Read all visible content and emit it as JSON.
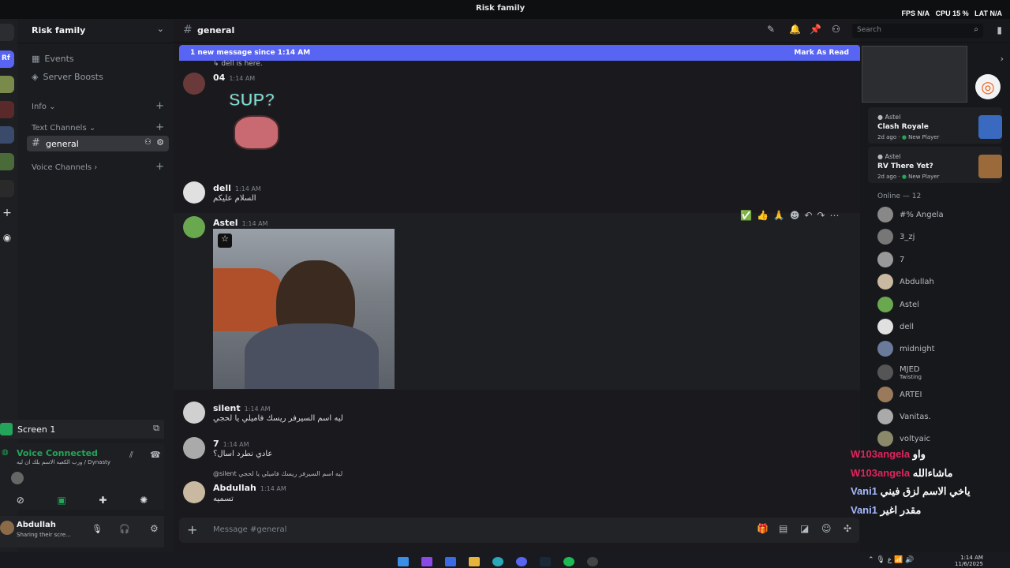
{
  "window": {
    "title": "Risk family"
  },
  "perf": {
    "fps_label": "FPS",
    "fps_value": "N/A",
    "cpu_label": "CPU",
    "cpu_value": "15 %",
    "lat_label": "LAT",
    "lat_value": "N/A"
  },
  "server": {
    "name": "Risk family"
  },
  "sidebar": {
    "events": "Events",
    "boosts": "Server Boosts",
    "info": "Info",
    "text_channels": "Text Channels",
    "general": "general",
    "voice_channels": "Voice Channels"
  },
  "screen_share": {
    "label": "Screen 1"
  },
  "voice": {
    "status": "Voice Connected",
    "details": "ورب الكعبه الاسم بلك ان ليه / Dynasty"
  },
  "user": {
    "name": "Abdullah",
    "status": "Sharing their scre..."
  },
  "header": {
    "channel": "general",
    "search_placeholder": "Search"
  },
  "banner": {
    "text": "1 new message since 1:14 AM",
    "action": "Mark As Read"
  },
  "messages": [
    {
      "reply": "dell is here."
    },
    {
      "author": "04",
      "time": "1:14 AM",
      "sticker": "SUP?"
    },
    {
      "author": "dell",
      "time": "1:14 AM",
      "text": "السلام عليكم"
    },
    {
      "author": "Astel",
      "time": "1:14 AM"
    },
    {
      "author": "silent",
      "time": "1:14 AM",
      "text": "ليه اسم السيرفر ريسك فاميلي يا لحجي"
    },
    {
      "author": "7",
      "time": "1:14 AM",
      "text": "عادي نطرد اسال؟"
    },
    {
      "author": "Abdullah",
      "time": "1:14 AM",
      "text": "تسميه",
      "reply_user": "@silent",
      "reply_text": "ليه اسم السيرفر ريسك فاميلي يا لحجي"
    }
  ],
  "composer": {
    "placeholder": "Message #general"
  },
  "activity": [
    {
      "user": "Astel",
      "game": "Clash Royale",
      "ago": "2d ago",
      "tag": "New Player"
    },
    {
      "user": "Astel",
      "game": "RV There Yet?",
      "ago": "2d ago",
      "tag": "New Player"
    }
  ],
  "online": {
    "header": "Online — 12"
  },
  "members": [
    {
      "name": "#% Angela",
      "color": "#b5bac1"
    },
    {
      "name": "3_zj",
      "color": "#b5bac1"
    },
    {
      "name": "7",
      "color": "#b5bac1"
    },
    {
      "name": "Abdullah",
      "color": "#b5bac1"
    },
    {
      "name": "Astel",
      "color": "#b5bac1"
    },
    {
      "name": "dell",
      "color": "#b5bac1"
    },
    {
      "name": "midnight",
      "color": "#b5bac1"
    },
    {
      "name": "MJED",
      "sub": "Twisting",
      "color": "#b5bac1"
    },
    {
      "name": "ARTEI",
      "color": "#b5bac1"
    },
    {
      "name": "Vanitas.",
      "color": "#b5bac1"
    },
    {
      "name": "voltyaic",
      "color": "#b5bac1"
    }
  ],
  "overlay_chat": [
    {
      "user": "W103angela",
      "text": "واو",
      "color": "#e0245e"
    },
    {
      "user": "W103angela",
      "text": "ماشاءالله",
      "color": "#e0245e"
    },
    {
      "user": "Vani1",
      "text": "ياخي الاسم لزق فيني",
      "color": "#a6b9ff"
    },
    {
      "user": "Vani1",
      "text": "مقدر اغير",
      "color": "#a6b9ff"
    }
  ],
  "clock": {
    "time": "1:14 AM",
    "date": "11/6/2025"
  },
  "colors": {
    "blurple": "#5865f2",
    "green": "#23a55a"
  }
}
